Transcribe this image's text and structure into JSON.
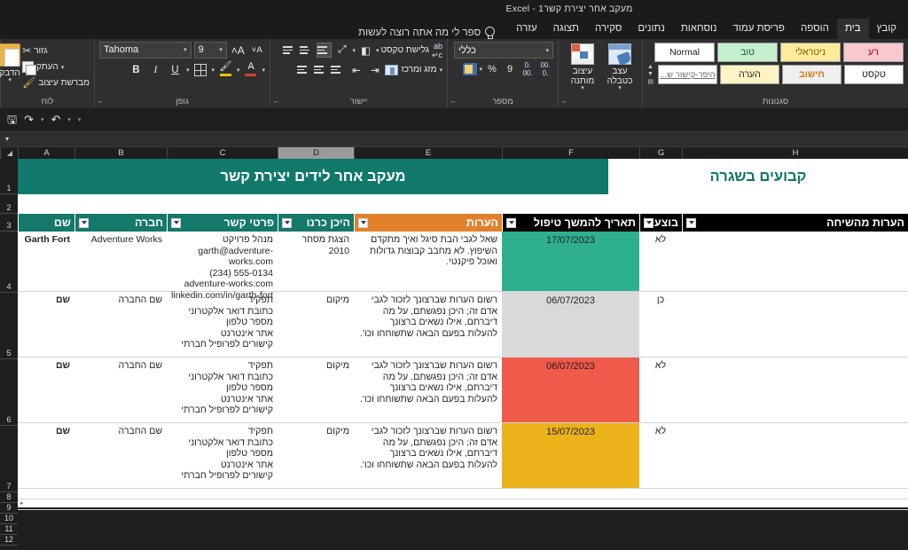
{
  "window": {
    "title": "מעקב אחר יצירת קשר1  -  Excel"
  },
  "ribbon": {
    "tabs": [
      {
        "label": "קובץ",
        "active": false
      },
      {
        "label": "בית",
        "active": true
      },
      {
        "label": "הוספה",
        "active": false
      },
      {
        "label": "פריסת עמוד",
        "active": false
      },
      {
        "label": "נוסחאות",
        "active": false
      },
      {
        "label": "נתונים",
        "active": false
      },
      {
        "label": "סקירה",
        "active": false
      },
      {
        "label": "תצוגה",
        "active": false
      },
      {
        "label": "עזרה",
        "active": false
      }
    ],
    "tell_me": "ספר לי מה אתה רוצה לעשות",
    "groups": {
      "clipboard": {
        "label": "לוח",
        "paste": "הדבק",
        "cut": "גזור",
        "copy": "העתק",
        "format_painter": "מברשת עיצוב"
      },
      "font": {
        "label": "גופן",
        "font_name": "Tahoma",
        "font_size": "9",
        "bold": "B",
        "italic": "I",
        "underline": "U"
      },
      "alignment": {
        "label": "יישור",
        "wrap_text": "גלישת טקסט",
        "merge_center": "מזג ומרכז"
      },
      "number": {
        "label": "מספר",
        "format": "כללי",
        "percent": "%",
        "comma": "9"
      },
      "styles": {
        "label": "סגנונות",
        "conditional_formatting": "עיצוב מותנה",
        "format_as_table": "עצב כטבלה",
        "cell_styles": [
          {
            "label": "Normal",
            "style": "sc-normal"
          },
          {
            "label": "טוב",
            "style": "sc-good"
          },
          {
            "label": "ניטראלי",
            "style": "sc-neutral"
          },
          {
            "label": "רע",
            "style": "sc-bad"
          },
          {
            "label": "היפר-קישור ש...",
            "style": "sc-link"
          },
          {
            "label": "הערה",
            "style": "sc-note"
          },
          {
            "label": "חישוב",
            "style": "sc-calc"
          },
          {
            "label": "טקסט",
            "style": "sc-text"
          }
        ]
      }
    }
  },
  "grid": {
    "columns": [
      "H",
      "G",
      "F",
      "E",
      "D",
      "C",
      "B",
      "A"
    ],
    "selected_column": "D",
    "row_numbers": [
      "1",
      "2",
      "3",
      "4",
      "5",
      "6",
      "7",
      "8",
      "9",
      "10",
      "11",
      "12"
    ],
    "banner": {
      "main_title": "מעקב אחר לידים יצירת קשר",
      "side_title": "קבועים בשגרה"
    },
    "headers": [
      {
        "label": "הערות מהשיחה",
        "color": "h-black"
      },
      {
        "label": "בוצע",
        "color": "h-black"
      },
      {
        "label": "תאריך להמשך טיפול",
        "color": "h-black"
      },
      {
        "label": "הערות",
        "color": "h-orange"
      },
      {
        "label": "היכן כרנו",
        "color": "h-teal"
      },
      {
        "label": "פרטי קשר",
        "color": "h-teal"
      },
      {
        "label": "חברה",
        "color": "h-teal"
      },
      {
        "label": "שם",
        "color": "h-teal"
      }
    ],
    "rows": [
      {
        "name": "Garth Fort",
        "company": "Adventure Works",
        "contact": "מנהל פרויקט\ngarth@adventure-works.com\n(234) 555-0134\nadventure-works.com\nlinkedin.com/in/garth-fort",
        "where_met": "הצגת מסחר 2010",
        "notes": "שאל לגבי הבת סיגל ואיך מתקדם השיפוץ. לא מחבב קבוצות גדולות ואוכל פיקנטי.",
        "followup_date": "17/07/2023",
        "date_fill": "f-teal",
        "done": "לא",
        "call_notes": ""
      },
      {
        "name": "שם",
        "company": "שם החברה",
        "contact": "תפקיד\nכתובת דואר אלקטרוני\nמספר טלפון\nאתר אינטרנט\nקישורים לפרופיל חברתי",
        "where_met": "מיקום",
        "notes": "רשום הערות שברצונך לזכור לגבי אדם זה; היכן נפגשתם, על מה דיברתם, אילו נשאים ברצונך להעלות בפעם הבאה שתשוחחו וכו'.",
        "followup_date": "06/07/2023",
        "date_fill": "f-gray",
        "done": "כן",
        "call_notes": ""
      },
      {
        "name": "שם",
        "company": "שם החברה",
        "contact": "תפקיד\nכתובת דואר אלקטרוני\nמספר טלפון\nאתר אינטרנט\nקישורים לפרופיל חברתי",
        "where_met": "מיקום",
        "notes": "רשום הערות שברצונך לזכור לגבי אדם זה; היכן נפגשתם, על מה דיברתם, אילו נשאים ברצונך להעלות בפעם הבאה שתשוחחו וכו'.",
        "followup_date": "06/07/2023",
        "date_fill": "f-red",
        "done": "לא",
        "call_notes": ""
      },
      {
        "name": "שם",
        "company": "שם החברה",
        "contact": "תפקיד\nכתובת דואר אלקטרוני\nמספר טלפון\nאתר אינטרנט\nקישורים לפרופיל חברתי",
        "where_met": "מיקום",
        "notes": "רשום הערות שברצונך לזכור לגבי אדם זה; היכן נפגשתם, על מה דיברתם, אילו נשאים ברצונך להעלות בפעם הבאה שתשוחחו וכו'.",
        "followup_date": "15/07/2023",
        "date_fill": "f-amber",
        "done": "לא",
        "call_notes": ""
      }
    ]
  }
}
